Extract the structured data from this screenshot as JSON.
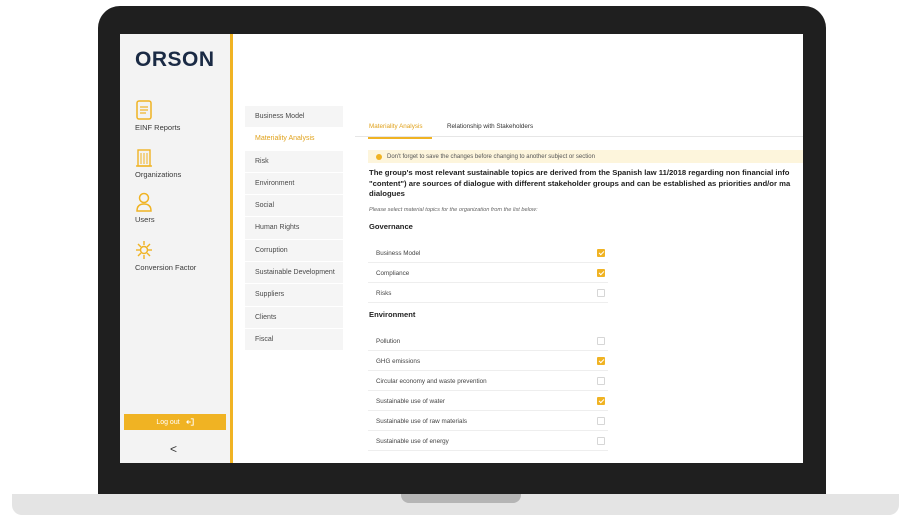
{
  "app": {
    "logo": "ORSON"
  },
  "sidebar": {
    "items": [
      {
        "label": "EINF Reports",
        "icon": "report-icon"
      },
      {
        "label": "Organizations",
        "icon": "building-icon"
      },
      {
        "label": "Users",
        "icon": "user-icon"
      },
      {
        "label": "Conversion Factor",
        "icon": "conversion-icon"
      }
    ],
    "logout_label": "Log out",
    "collapse_glyph": "<"
  },
  "subnav": {
    "items": [
      {
        "label": "Business Model",
        "active": false
      },
      {
        "label": "Materiality Analysis",
        "active": true
      },
      {
        "label": "Risk",
        "active": false
      },
      {
        "label": "Environment",
        "active": false
      },
      {
        "label": "Social",
        "active": false
      },
      {
        "label": "Human Rights",
        "active": false
      },
      {
        "label": "Corruption",
        "active": false
      },
      {
        "label": "Sustainable Development",
        "active": false
      },
      {
        "label": "Suppliers",
        "active": false
      },
      {
        "label": "Clients",
        "active": false
      },
      {
        "label": "Fiscal",
        "active": false
      }
    ]
  },
  "main": {
    "tabs": [
      {
        "label": "Materiality Analysis",
        "active": true
      },
      {
        "label": "Relationship with Stakeholders",
        "active": false
      }
    ],
    "notice": "Don't forget to save the changes before changing to another subject or section",
    "intro_lines": [
      "The group's most relevant sustainable topics are derived from the Spanish law 11/2018 regarding non financial info",
      "\"content\") are sources of dialogue with different stakeholder groups and can be established as priorities and/or ma",
      "dialogues"
    ],
    "hint": "Please select material topics for the organization from the list below:",
    "sections": [
      {
        "title": "Governance",
        "topics": [
          {
            "label": "Business Model",
            "checked": true
          },
          {
            "label": "Compliance",
            "checked": true
          },
          {
            "label": "Risks",
            "checked": false
          }
        ]
      },
      {
        "title": "Environment",
        "topics": [
          {
            "label": "Pollution",
            "checked": false
          },
          {
            "label": "GHG emissions",
            "checked": true
          },
          {
            "label": "Circular economy and waste prevention",
            "checked": false
          },
          {
            "label": "Sustainable use of water",
            "checked": true
          },
          {
            "label": "Sustainable use of raw materials",
            "checked": false
          },
          {
            "label": "Sustainable use of energy",
            "checked": false
          }
        ]
      }
    ]
  },
  "colors": {
    "accent": "#f0b323",
    "logo": "#1a2a44"
  }
}
